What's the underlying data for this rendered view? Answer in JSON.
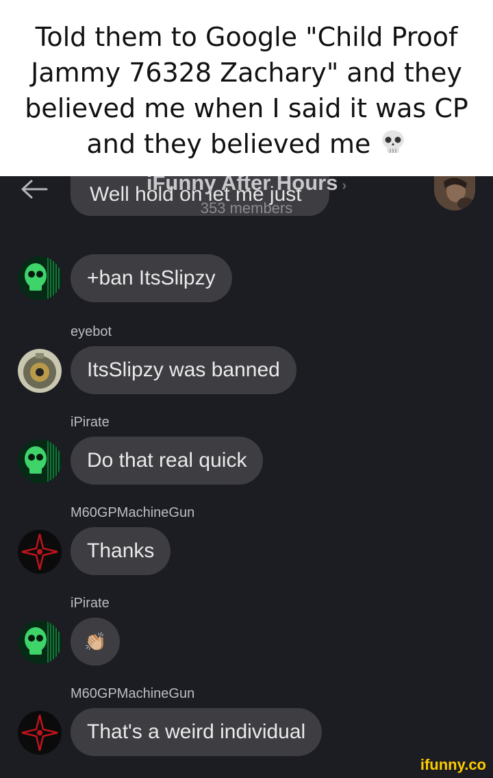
{
  "caption": {
    "text": "Told them to Google \"Child Proof Jammy 76328 Zachary\" and they believed me when I said it was CP and they believed me",
    "emoji": "skull-emoji"
  },
  "header": {
    "title": "iFunny After Hours",
    "members": "353 members"
  },
  "cut_message": "Well hold on let me just",
  "messages": [
    {
      "sender": "",
      "text": "+ban ItsSlipzy",
      "avatar": "green-skull-avatar"
    },
    {
      "sender": "eyebot",
      "text": "ItsSlipzy was banned",
      "avatar": "eyebot-avatar"
    },
    {
      "sender": "iPirate",
      "text": "Do that real quick",
      "avatar": "green-skull-avatar"
    },
    {
      "sender": "M60GPMachineGun",
      "text": "Thanks",
      "avatar": "red-star-avatar"
    },
    {
      "sender": "iPirate",
      "text": "👏🏼",
      "avatar": "green-skull-avatar"
    },
    {
      "sender": "M60GPMachineGun",
      "text": "That's a weird individual",
      "avatar": "red-star-avatar"
    }
  ],
  "watermark": "ifunny.co",
  "colors": {
    "background": "#1c1d22",
    "bubble": "#3d3d42",
    "brand": "#ffcc00"
  }
}
